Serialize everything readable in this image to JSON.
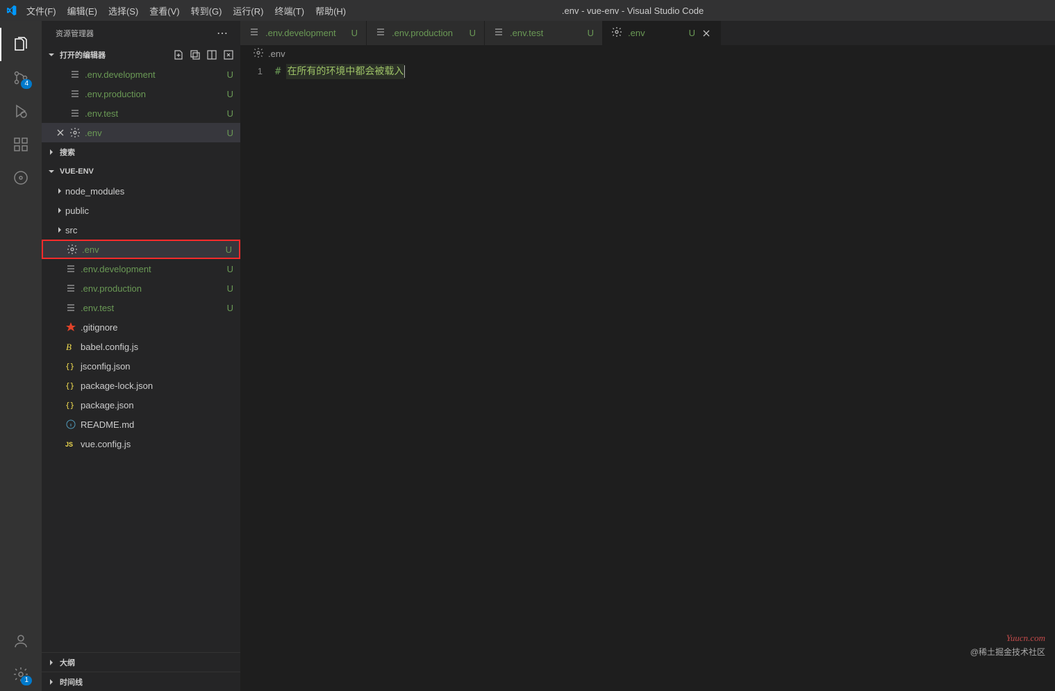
{
  "title_bar": {
    "menus": [
      "文件(F)",
      "编辑(E)",
      "选择(S)",
      "查看(V)",
      "转到(G)",
      "运行(R)",
      "终端(T)",
      "帮助(H)"
    ],
    "title": ".env - vue-env - Visual Studio Code"
  },
  "activity": {
    "scm_badge": "4",
    "settings_badge": "1"
  },
  "sidebar": {
    "header": "资源管理器",
    "open_editors_label": "打开的编辑器",
    "open_editors": [
      {
        "icon": "lines",
        "name": ".env.development",
        "status": "U",
        "close": false
      },
      {
        "icon": "lines",
        "name": ".env.production",
        "status": "U",
        "close": false
      },
      {
        "icon": "lines",
        "name": ".env.test",
        "status": "U",
        "close": false
      },
      {
        "icon": "gear",
        "name": ".env",
        "status": "U",
        "close": true,
        "active": true
      }
    ],
    "search_label": "搜索",
    "project_label": "VUE-ENV",
    "files": [
      {
        "type": "folder",
        "name": "node_modules"
      },
      {
        "type": "folder",
        "name": "public"
      },
      {
        "type": "folder",
        "name": "src"
      },
      {
        "type": "file",
        "icon": "gear",
        "name": ".env",
        "status": "U",
        "highlight": true,
        "untracked": true
      },
      {
        "type": "file",
        "icon": "lines",
        "name": ".env.development",
        "status": "U",
        "untracked": true
      },
      {
        "type": "file",
        "icon": "lines",
        "name": ".env.production",
        "status": "U",
        "untracked": true
      },
      {
        "type": "file",
        "icon": "lines",
        "name": ".env.test",
        "status": "U",
        "untracked": true
      },
      {
        "type": "file",
        "icon": "gitignore",
        "name": ".gitignore"
      },
      {
        "type": "file",
        "icon": "babel",
        "name": "babel.config.js"
      },
      {
        "type": "file",
        "icon": "json",
        "name": "jsconfig.json"
      },
      {
        "type": "file",
        "icon": "json",
        "name": "package-lock.json"
      },
      {
        "type": "file",
        "icon": "json",
        "name": "package.json"
      },
      {
        "type": "file",
        "icon": "info",
        "name": "README.md"
      },
      {
        "type": "file",
        "icon": "js",
        "name": "vue.config.js"
      }
    ],
    "outline_label": "大纲",
    "timeline_label": "时间线"
  },
  "tabs": [
    {
      "icon": "lines",
      "label": ".env.development",
      "status": "U"
    },
    {
      "icon": "lines",
      "label": ".env.production",
      "status": "U"
    },
    {
      "icon": "lines",
      "label": ".env.test",
      "status": "U"
    },
    {
      "icon": "gear",
      "label": ".env",
      "status": "U",
      "active": true,
      "closeable": true
    }
  ],
  "breadcrumb": ".env",
  "editor": {
    "line_number": "1",
    "hash": "#",
    "comment": "在所有的环境中都会被载入"
  },
  "watermarks": {
    "yuucn": "Yuucn.com",
    "community": "@稀土掘金技术社区"
  }
}
